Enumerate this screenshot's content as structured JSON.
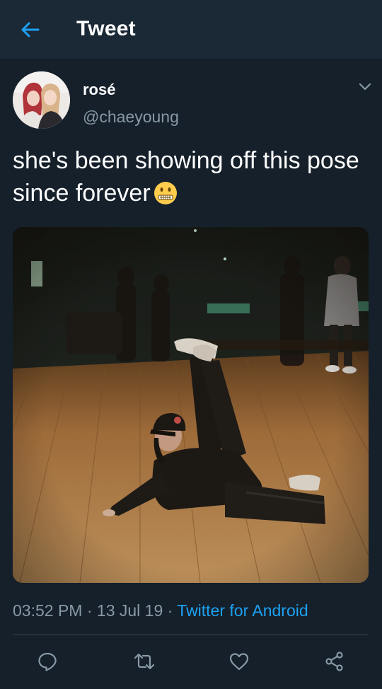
{
  "header": {
    "title": "Tweet",
    "back_icon": "arrow-left-icon",
    "accent_color": "#1da1f2"
  },
  "tweet": {
    "author_name": "rosé",
    "author_handle": "@chaeyoung",
    "text": "she's been showing off this pose since forever",
    "emoji": "zipper-mouth-face",
    "time": "03:52 PM",
    "date": "13 Jul 19",
    "source": "Twitter for Android",
    "media_alt": "photo"
  },
  "actions": [
    {
      "name": "reply",
      "icon": "reply-icon"
    },
    {
      "name": "retweet",
      "icon": "retweet-icon"
    },
    {
      "name": "like",
      "icon": "heart-icon"
    },
    {
      "name": "share",
      "icon": "share-icon"
    }
  ],
  "colors": {
    "background": "#15202b",
    "header_background": "#1b2836",
    "secondary_text": "#8899a6",
    "link": "#1da1f2",
    "divider": "#38444d"
  }
}
